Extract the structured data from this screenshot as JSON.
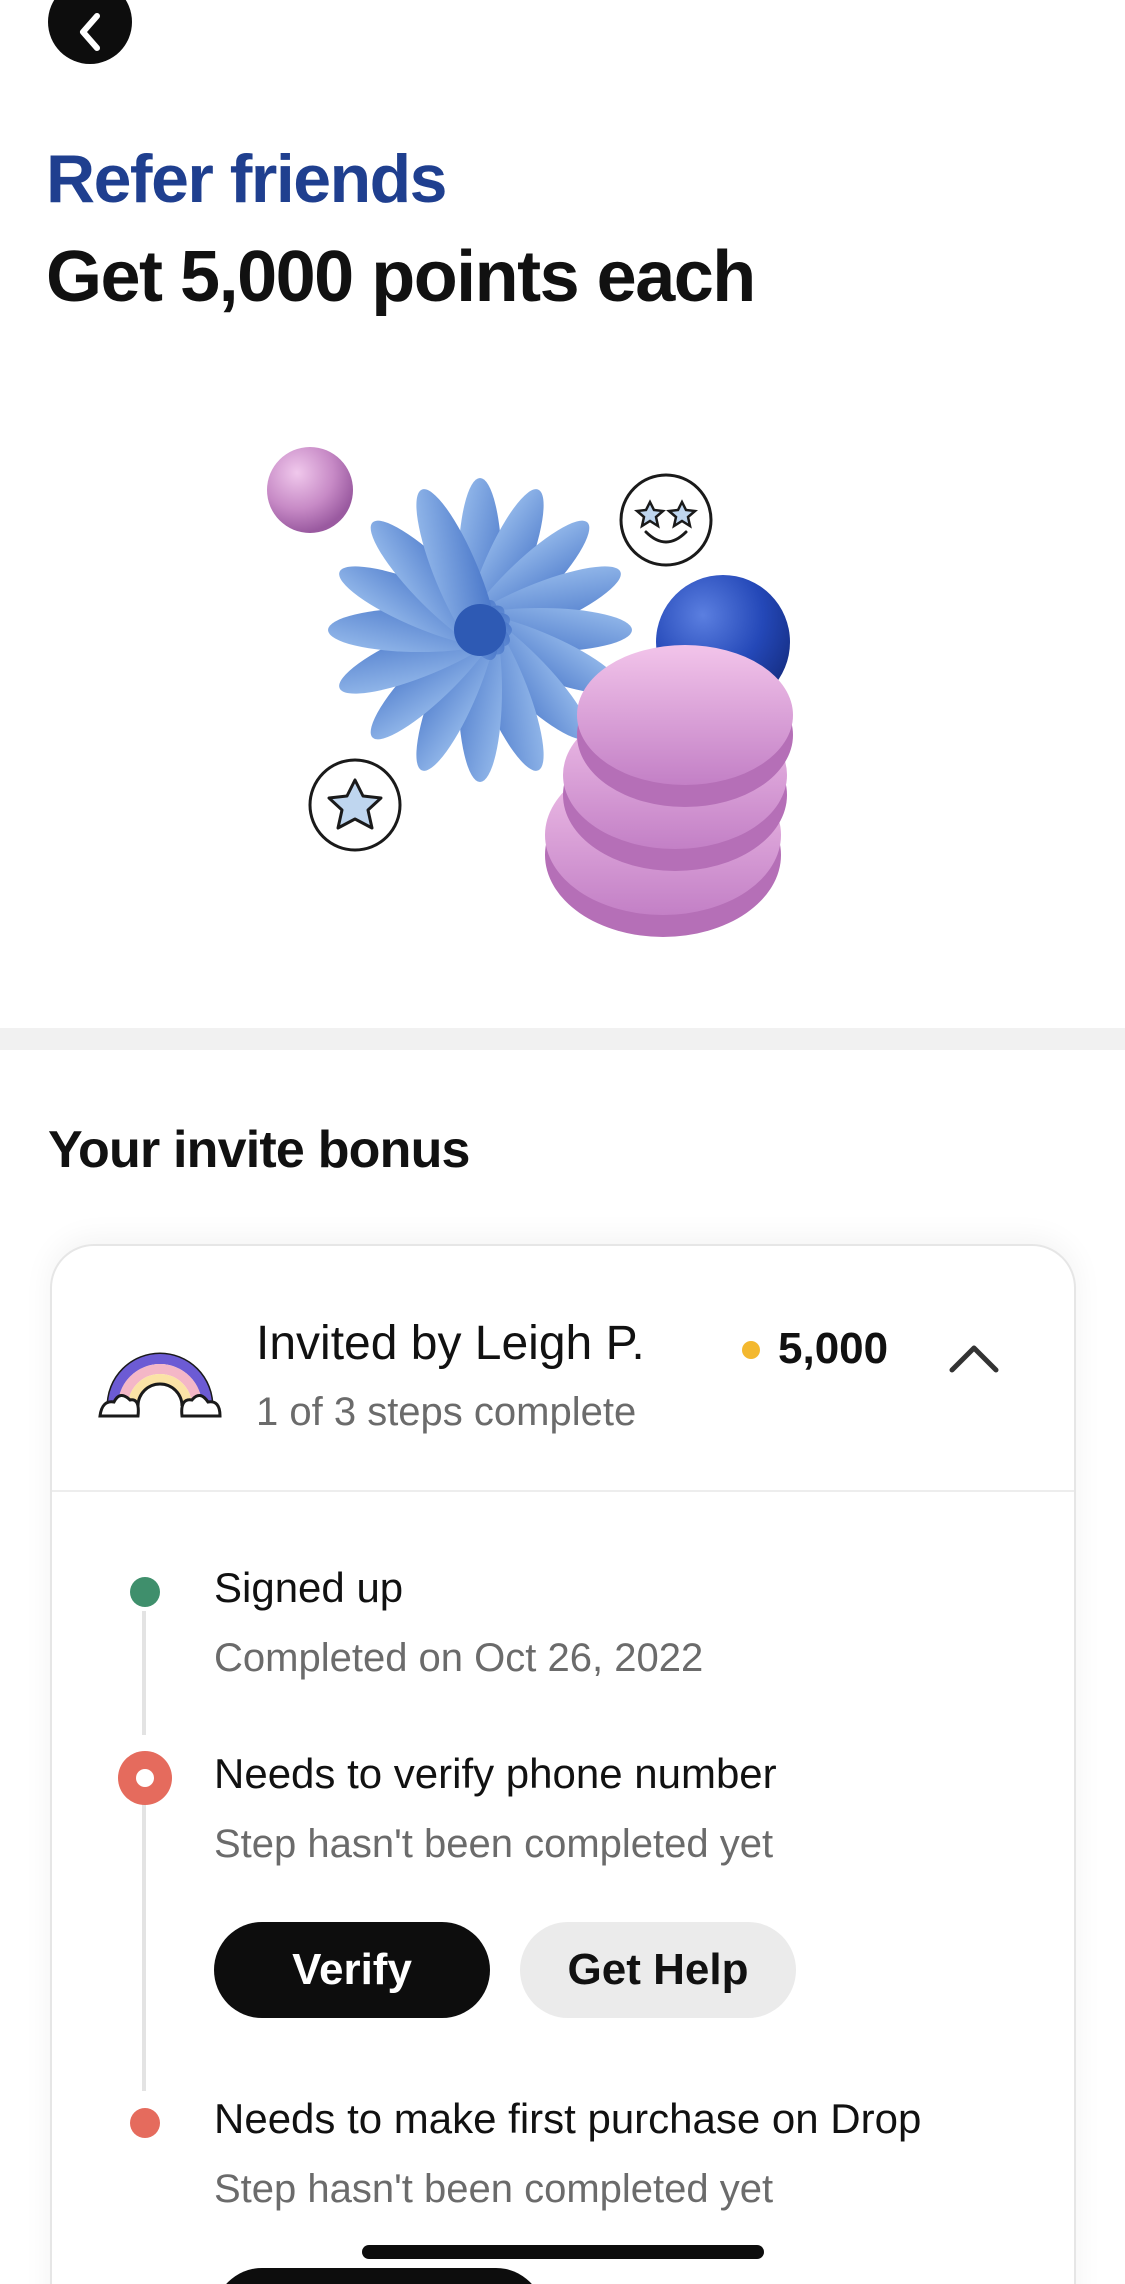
{
  "header": {
    "back_icon": "chevron-left-icon",
    "eyebrow": "Refer friends",
    "headline": "Get 5,000 points each"
  },
  "invite_section": {
    "title": "Your invite bonus",
    "card": {
      "inviter": "Invited by Leigh P.",
      "progress_text": "1 of 3 steps complete",
      "points": "5,000",
      "points_color": "#f3b82f",
      "collapse_icon": "chevron-up-icon",
      "steps": [
        {
          "title": "Signed up",
          "subtitle": "Completed on Oct 26, 2022",
          "status": "complete",
          "color": "#3f8f6c"
        },
        {
          "title": "Needs to verify phone number",
          "subtitle": "Step hasn't been completed yet",
          "status": "current",
          "color": "#e56b5d",
          "actions": {
            "primary": "Verify",
            "secondary": "Get Help"
          }
        },
        {
          "title": "Needs to make first purchase on Drop",
          "subtitle": "Step hasn't been completed yet",
          "status": "pending",
          "color": "#e56b5d"
        }
      ]
    }
  },
  "colors": {
    "brand_blue": "#1f3f8f",
    "primary_button": "#0d0d0d"
  }
}
